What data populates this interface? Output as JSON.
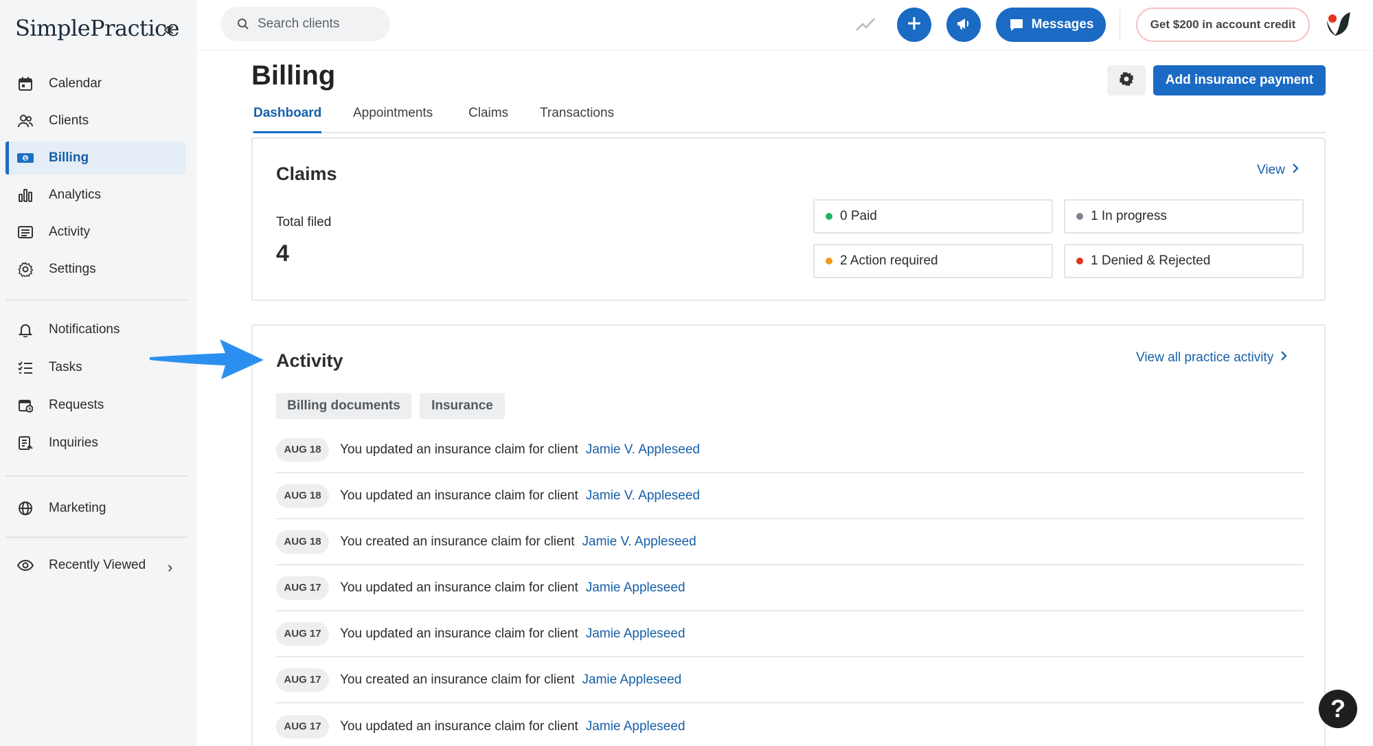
{
  "app": {
    "logo_text": "SimplePractice",
    "collapse_glyph": "«"
  },
  "sidebar": {
    "primary": [
      {
        "label": "Calendar",
        "icon": "calendar-icon"
      },
      {
        "label": "Clients",
        "icon": "users-icon"
      },
      {
        "label": "Billing",
        "icon": "billing-icon",
        "active": true
      },
      {
        "label": "Analytics",
        "icon": "analytics-icon"
      },
      {
        "label": "Activity",
        "icon": "activity-icon"
      },
      {
        "label": "Settings",
        "icon": "gear-icon"
      }
    ],
    "secondary": [
      {
        "label": "Notifications",
        "icon": "bell-icon"
      },
      {
        "label": "Tasks",
        "icon": "tasks-icon"
      },
      {
        "label": "Requests",
        "icon": "requests-icon"
      },
      {
        "label": "Inquiries",
        "icon": "inquiries-icon"
      }
    ],
    "marketing": {
      "label": "Marketing",
      "icon": "globe-icon"
    },
    "recently_viewed": {
      "label": "Recently Viewed",
      "icon": "eye-icon",
      "chevron": "›"
    }
  },
  "topbar": {
    "search_placeholder": "Search clients",
    "messages_label": "Messages",
    "credit_label": "Get $200 in account credit"
  },
  "header": {
    "title": "Billing",
    "primary_button": "Add insurance payment",
    "tabs": [
      {
        "label": "Dashboard",
        "active": true
      },
      {
        "label": "Appointments"
      },
      {
        "label": "Claims"
      },
      {
        "label": "Transactions"
      }
    ]
  },
  "claims": {
    "title": "Claims",
    "view_link": "View",
    "total_label": "Total filed",
    "total_value": "4",
    "statuses": [
      {
        "label": "0 Paid",
        "color": "#1fb45c"
      },
      {
        "label": "1 In progress",
        "color": "#7a8590"
      },
      {
        "label": "2 Action required",
        "color": "#f39b16"
      },
      {
        "label": "1 Denied & Rejected",
        "color": "#e5351f"
      }
    ]
  },
  "activity": {
    "title": "Activity",
    "view_all_link": "View all practice activity",
    "chips": [
      "Billing documents",
      "Insurance"
    ],
    "rows": [
      {
        "date": "AUG 18",
        "text": "You updated an insurance claim for client",
        "client": "Jamie V. Appleseed"
      },
      {
        "date": "AUG 18",
        "text": "You updated an insurance claim for client",
        "client": "Jamie V. Appleseed"
      },
      {
        "date": "AUG 18",
        "text": "You created an insurance claim for client",
        "client": "Jamie V. Appleseed"
      },
      {
        "date": "AUG 17",
        "text": "You updated an insurance claim for client",
        "client": "Jamie Appleseed"
      },
      {
        "date": "AUG 17",
        "text": "You updated an insurance claim for client",
        "client": "Jamie Appleseed"
      },
      {
        "date": "AUG 17",
        "text": "You created an insurance claim for client",
        "client": "Jamie Appleseed"
      },
      {
        "date": "AUG 17",
        "text": "You updated an insurance claim for client",
        "client": "Jamie Appleseed"
      }
    ]
  },
  "help": {
    "glyph": "?"
  },
  "colors": {
    "accent": "#1b6ac4",
    "link": "#155fa8",
    "sidebar_bg": "#f4f5f6",
    "annotation_arrow": "#2b8ff0"
  }
}
